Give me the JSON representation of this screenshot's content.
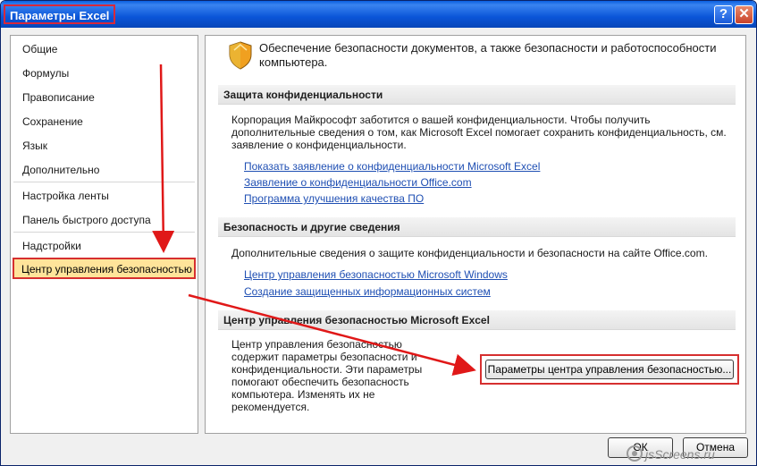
{
  "window": {
    "title": "Параметры Excel"
  },
  "titlebar": {
    "help_glyph": "?",
    "close_glyph": "✕"
  },
  "sidebar": {
    "items": [
      {
        "label": "Общие"
      },
      {
        "label": "Формулы"
      },
      {
        "label": "Правописание"
      },
      {
        "label": "Сохранение"
      },
      {
        "label": "Язык"
      },
      {
        "label": "Дополнительно"
      },
      {
        "label": "Настройка ленты"
      },
      {
        "label": "Панель быстрого доступа"
      },
      {
        "label": "Надстройки"
      },
      {
        "label": "Центр управления безопасностью",
        "selected": true
      }
    ]
  },
  "main": {
    "icon": "shield-icon",
    "intro": "Обеспечение безопасности документов, а также безопасности и работоспособности компьютера.",
    "sections": [
      {
        "heading": "Защита конфиденциальности",
        "text": "Корпорация Майкрософт заботится о вашей конфиденциальности. Чтобы получить дополнительные сведения о том, как Microsoft Excel помогает сохранить конфиденциальность, см. заявление о конфиденциальности.",
        "links": [
          "Показать заявление о конфиденциальности Microsoft Excel",
          "Заявление о конфиденциальности Office.com",
          "Программа улучшения качества ПО"
        ]
      },
      {
        "heading": "Безопасность и другие сведения",
        "text": "Дополнительные сведения о защите конфиденциальности и безопасности на сайте Office.com.",
        "links": [
          "Центр управления безопасностью Microsoft Windows",
          "Создание защищенных информационных систем"
        ]
      },
      {
        "heading": "Центр управления безопасностью Microsoft Excel",
        "text": "Центр управления безопасностью содержит параметры безопасности и конфиденциальности. Эти параметры помогают обеспечить безопасность компьютера. Изменять их не рекомендуется.",
        "button": "Параметры центра управления безопасностью..."
      }
    ]
  },
  "footer": {
    "ok_label": "ОК",
    "cancel_label": "Отмена"
  },
  "watermark": {
    "text": "jsScreens.ru"
  },
  "colors": {
    "highlight_border": "#d62f2f",
    "selected_fill": "#ffe49a",
    "link": "#1f4fb3",
    "titlebar": "#0a55d8"
  }
}
